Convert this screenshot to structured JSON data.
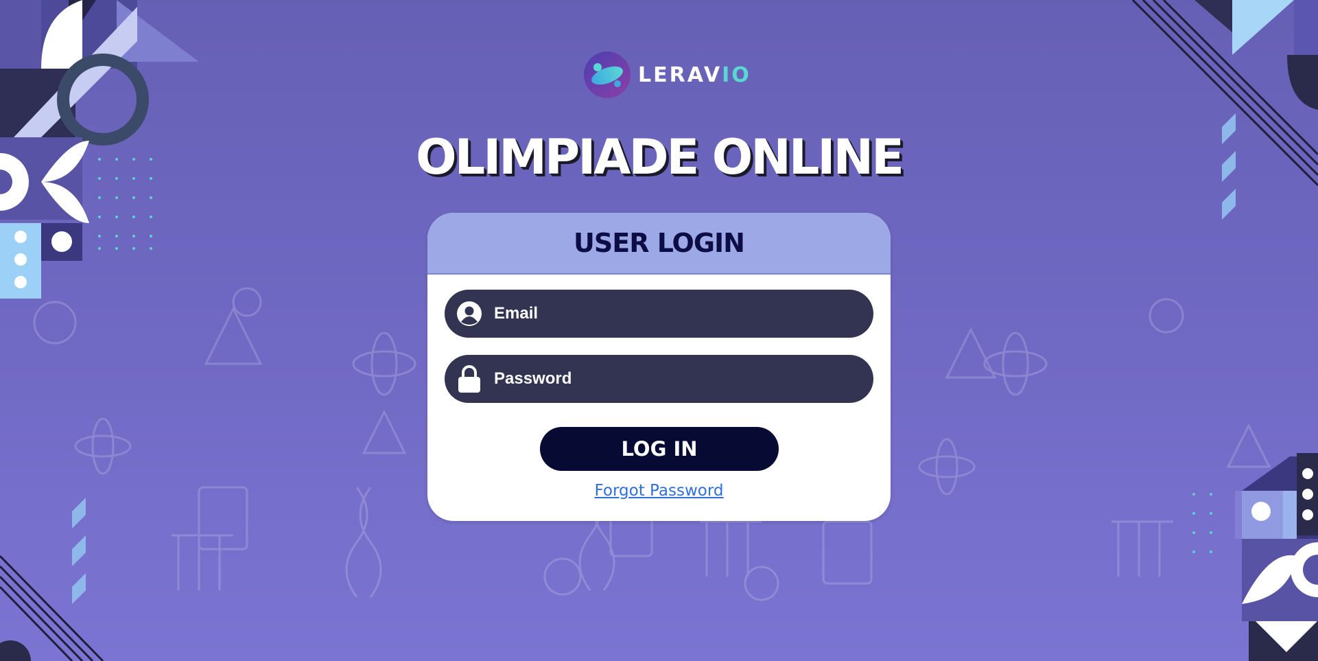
{
  "brand": {
    "name_main": "LERAV",
    "name_accent": "IO",
    "accent_color": "#5ad7d3"
  },
  "page": {
    "title": "OLIMPIADE ONLINE"
  },
  "login": {
    "header": "USER LOGIN",
    "email_placeholder": "Email",
    "email_icon": "user-icon",
    "password_placeholder": "Password",
    "password_icon": "lock-icon",
    "submit_label": "LOG IN",
    "forgot_label": "Forgot Password"
  },
  "colors": {
    "background": "#6c66be",
    "header_band": "#9da8e6",
    "field": "#333352",
    "button": "#070a33",
    "link": "#2f6ee0"
  }
}
